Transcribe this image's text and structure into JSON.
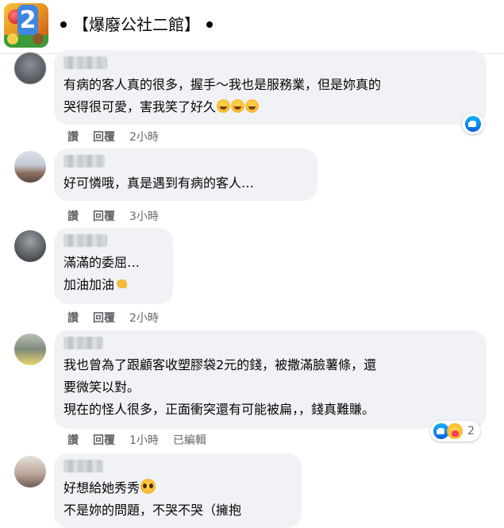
{
  "header": {
    "title": "【爆廢公社二館】"
  },
  "comments": [
    {
      "lines": [
        "有病的客人真的很多，握手～我也是服務業，但是妳真的",
        "哭得很可愛，害我笑了好久"
      ],
      "emojis": [
        "laugh",
        "laugh",
        "laugh"
      ],
      "like_label": "讚",
      "reply_label": "回覆",
      "time": "2小時",
      "reactions": [
        "like"
      ]
    },
    {
      "lines": [
        "好可憐哦，真是遇到有病的客人…"
      ],
      "like_label": "讚",
      "reply_label": "回覆",
      "time": "3小時"
    },
    {
      "lines": [
        "滿滿的委屈…",
        "加油加油"
      ],
      "emojis": [
        "flex"
      ],
      "like_label": "讚",
      "reply_label": "回覆",
      "time": "2小時"
    },
    {
      "lines": [
        "我也曾為了跟顧客收塑膠袋2元的錢，被撒滿臉薯條，還",
        "要微笑以對。",
        "現在的怪人很多，正面衝突還有可能被扁，，錢真難賺。"
      ],
      "like_label": "讚",
      "reply_label": "回覆",
      "time": "1小時",
      "edited": "已編輯",
      "reactions": [
        "like",
        "care"
      ],
      "reaction_count": "2"
    },
    {
      "lines": [
        "好想給她秀秀",
        "不是妳的問題，不哭不哭（擁抱"
      ],
      "emojis": [
        "plead"
      ]
    }
  ]
}
